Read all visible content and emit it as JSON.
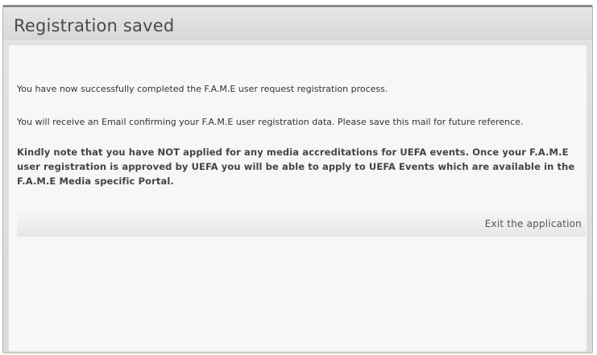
{
  "dialog": {
    "title": "Registration saved",
    "messages": {
      "completed": "You have now successfully completed the F.A.M.E user request registration process.",
      "email": "You will receive an Email confirming your F.A.M.E user registration data. Please save this mail for future reference.",
      "note": "Kindly note that you have NOT applied for any media accreditations for UEFA events. Once your F.A.M.E user registration is approved by UEFA you will be able to apply to UEFA Events which are available in the F.A.M.E Media specific Portal."
    },
    "exit_label": "Exit the application"
  }
}
